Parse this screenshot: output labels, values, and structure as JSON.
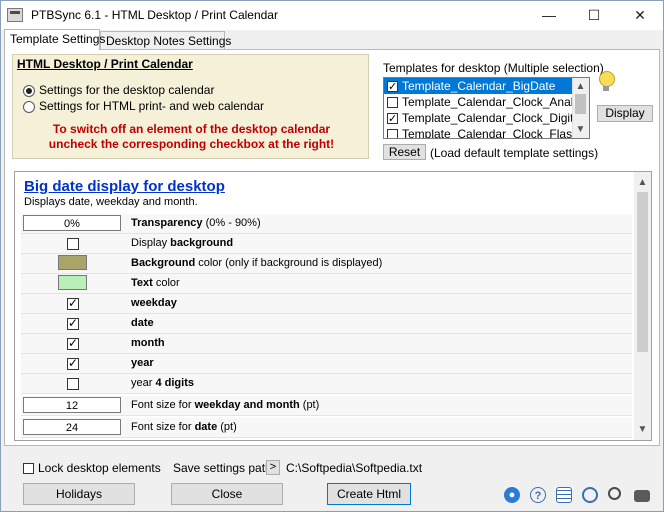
{
  "window": {
    "title": "PTBSync 6.1 - HTML Desktop / Print Calendar",
    "minimize_glyph": "—",
    "maximize_glyph": "☐",
    "close_glyph": "✕"
  },
  "tabs": [
    {
      "label": "Template Settings",
      "active": true
    },
    {
      "label": "Desktop Notes Settings",
      "active": false
    }
  ],
  "left_box": {
    "title": "HTML Desktop / Print Calendar",
    "radio_desktop": "Settings for the desktop calendar",
    "radio_print": "Settings for HTML print- and web calendar",
    "info_line1": "To switch off an element of the desktop calendar",
    "info_line2": "uncheck the corresponding checkbox at the right!",
    "selected": "desktop"
  },
  "templates": {
    "label": "Templates for desktop  (Multiple selection)",
    "items": [
      {
        "name": "Template_Calendar_BigDate",
        "checked": true,
        "selected": true
      },
      {
        "name": "Template_Calendar_Clock_Analog",
        "checked": false,
        "selected": false
      },
      {
        "name": "Template_Calendar_Clock_Digital",
        "checked": true,
        "selected": false
      },
      {
        "name": "Template_Calendar_Clock_Flash",
        "checked": false,
        "selected": false
      }
    ],
    "display_button": "Display",
    "reset_button": "Reset",
    "reset_note": "(Load default template settings)"
  },
  "settings": {
    "title": "Big date display for desktop",
    "subtitle": "Displays date, weekday and month.",
    "rows": [
      {
        "type": "value",
        "value": "0%",
        "bold": "Transparency",
        "rest": " (0% - 90%)",
        "pre": ""
      },
      {
        "type": "check",
        "checked": false,
        "pre": "Display ",
        "bold": "background",
        "rest": ""
      },
      {
        "type": "color",
        "color": "#a8a46a",
        "pre": "",
        "bold": "Background",
        "rest": " color (only if background is displayed)"
      },
      {
        "type": "color",
        "color": "#b8f0b8",
        "pre": "",
        "bold": "Text",
        "rest": " color"
      },
      {
        "type": "check",
        "checked": true,
        "pre": "",
        "bold": "weekday",
        "rest": ""
      },
      {
        "type": "check",
        "checked": true,
        "pre": "",
        "bold": "date",
        "rest": ""
      },
      {
        "type": "check",
        "checked": true,
        "pre": "",
        "bold": "month",
        "rest": ""
      },
      {
        "type": "check",
        "checked": true,
        "pre": "",
        "bold": "year",
        "rest": ""
      },
      {
        "type": "check",
        "checked": false,
        "pre": "year ",
        "bold": "4 digits",
        "rest": ""
      },
      {
        "type": "value",
        "value": "12",
        "pre": "Font size for ",
        "bold": "weekday and month",
        "rest": " (pt)"
      },
      {
        "type": "value",
        "value": "24",
        "pre": "Font size for ",
        "bold": "date",
        "rest": " (pt)"
      }
    ]
  },
  "footer": {
    "lock_label": "Lock desktop elements",
    "lock_checked": false,
    "save_label": "Save settings path",
    "save_arrow": ">",
    "save_path": "C:\\Softpedia\\Softpedia.txt",
    "holidays_button": "Holidays",
    "close_button": "Close",
    "create_button": "Create Html"
  },
  "icons": [
    "globe-icon",
    "help-icon",
    "calendar-icon",
    "clock-icon",
    "zoom-icon",
    "printer-icon"
  ]
}
